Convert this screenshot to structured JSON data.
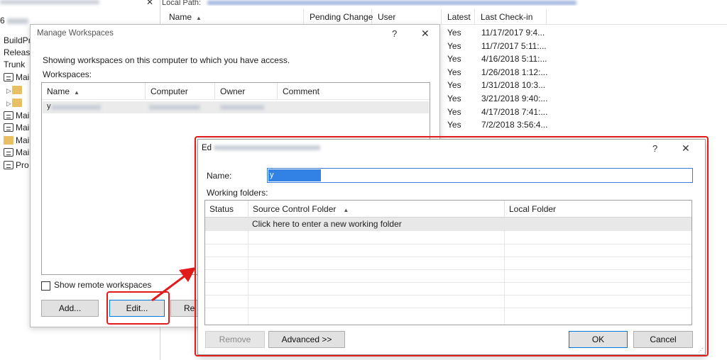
{
  "explorer": {
    "local_path_label": "Local Path:",
    "tree_items": [
      {
        "label": "BuildPr",
        "icon": "none"
      },
      {
        "label": "Release",
        "icon": "none"
      },
      {
        "label": "Trunk",
        "icon": "none"
      },
      {
        "label": "Mai",
        "icon": "branch-icon"
      },
      {
        "label": "",
        "icon": "folder-icon"
      },
      {
        "label": "",
        "icon": "folder-icon"
      },
      {
        "label": "Mai",
        "icon": "branch-icon"
      },
      {
        "label": "Mai",
        "icon": "branch-icon"
      },
      {
        "label": "Mai",
        "icon": "folder-icon"
      },
      {
        "label": "Mai",
        "icon": "branch-icon"
      },
      {
        "label": "Pro",
        "icon": "branch-icon"
      }
    ],
    "columns": {
      "name": "Name",
      "pending_change": "Pending Change",
      "user": "User",
      "latest": "Latest",
      "last_checkin": "Last Check-in"
    },
    "rows": [
      {
        "latest": "Yes",
        "date": "11/17/2017 9:4..."
      },
      {
        "latest": "Yes",
        "date": "11/7/2017 5:11:..."
      },
      {
        "latest": "Yes",
        "date": "4/16/2018 5:11:..."
      },
      {
        "latest": "Yes",
        "date": "1/26/2018 1:12:..."
      },
      {
        "latest": "Yes",
        "date": "1/31/2018 10:3..."
      },
      {
        "latest": "Yes",
        "date": "3/21/2018 9:40:..."
      },
      {
        "latest": "Yes",
        "date": "4/17/2018 7:41:..."
      },
      {
        "latest": "Yes",
        "date": "7/2/2018 3:56:4..."
      }
    ]
  },
  "manage_dialog": {
    "title": "Manage Workspaces",
    "help": "?",
    "close": "✕",
    "info": "Showing workspaces on this computer to which you have access.",
    "workspaces_label": "Workspaces:",
    "columns": {
      "name": "Name",
      "computer": "Computer",
      "owner": "Owner",
      "comment": "Comment"
    },
    "row_initial": "y",
    "show_remote_label": "Show remote workspaces",
    "buttons": {
      "add": "Add...",
      "edit": "Edit...",
      "remove_partial": "Re"
    }
  },
  "edit_dialog": {
    "title_prefix": "Ed",
    "help": "?",
    "close": "✕",
    "name_label": "Name:",
    "name_value": "y",
    "working_folders_label": "Working folders:",
    "columns": {
      "status": "Status",
      "source": "Source Control Folder",
      "local": "Local Folder"
    },
    "new_row_text": "Click here to enter a new working folder",
    "buttons": {
      "remove": "Remove",
      "advanced": "Advanced >>",
      "ok": "OK",
      "cancel": "Cancel"
    }
  },
  "colors": {
    "annotation_red": "#e11b1b",
    "selection_blue": "#3282e6",
    "focus_blue": "#0078d7"
  }
}
